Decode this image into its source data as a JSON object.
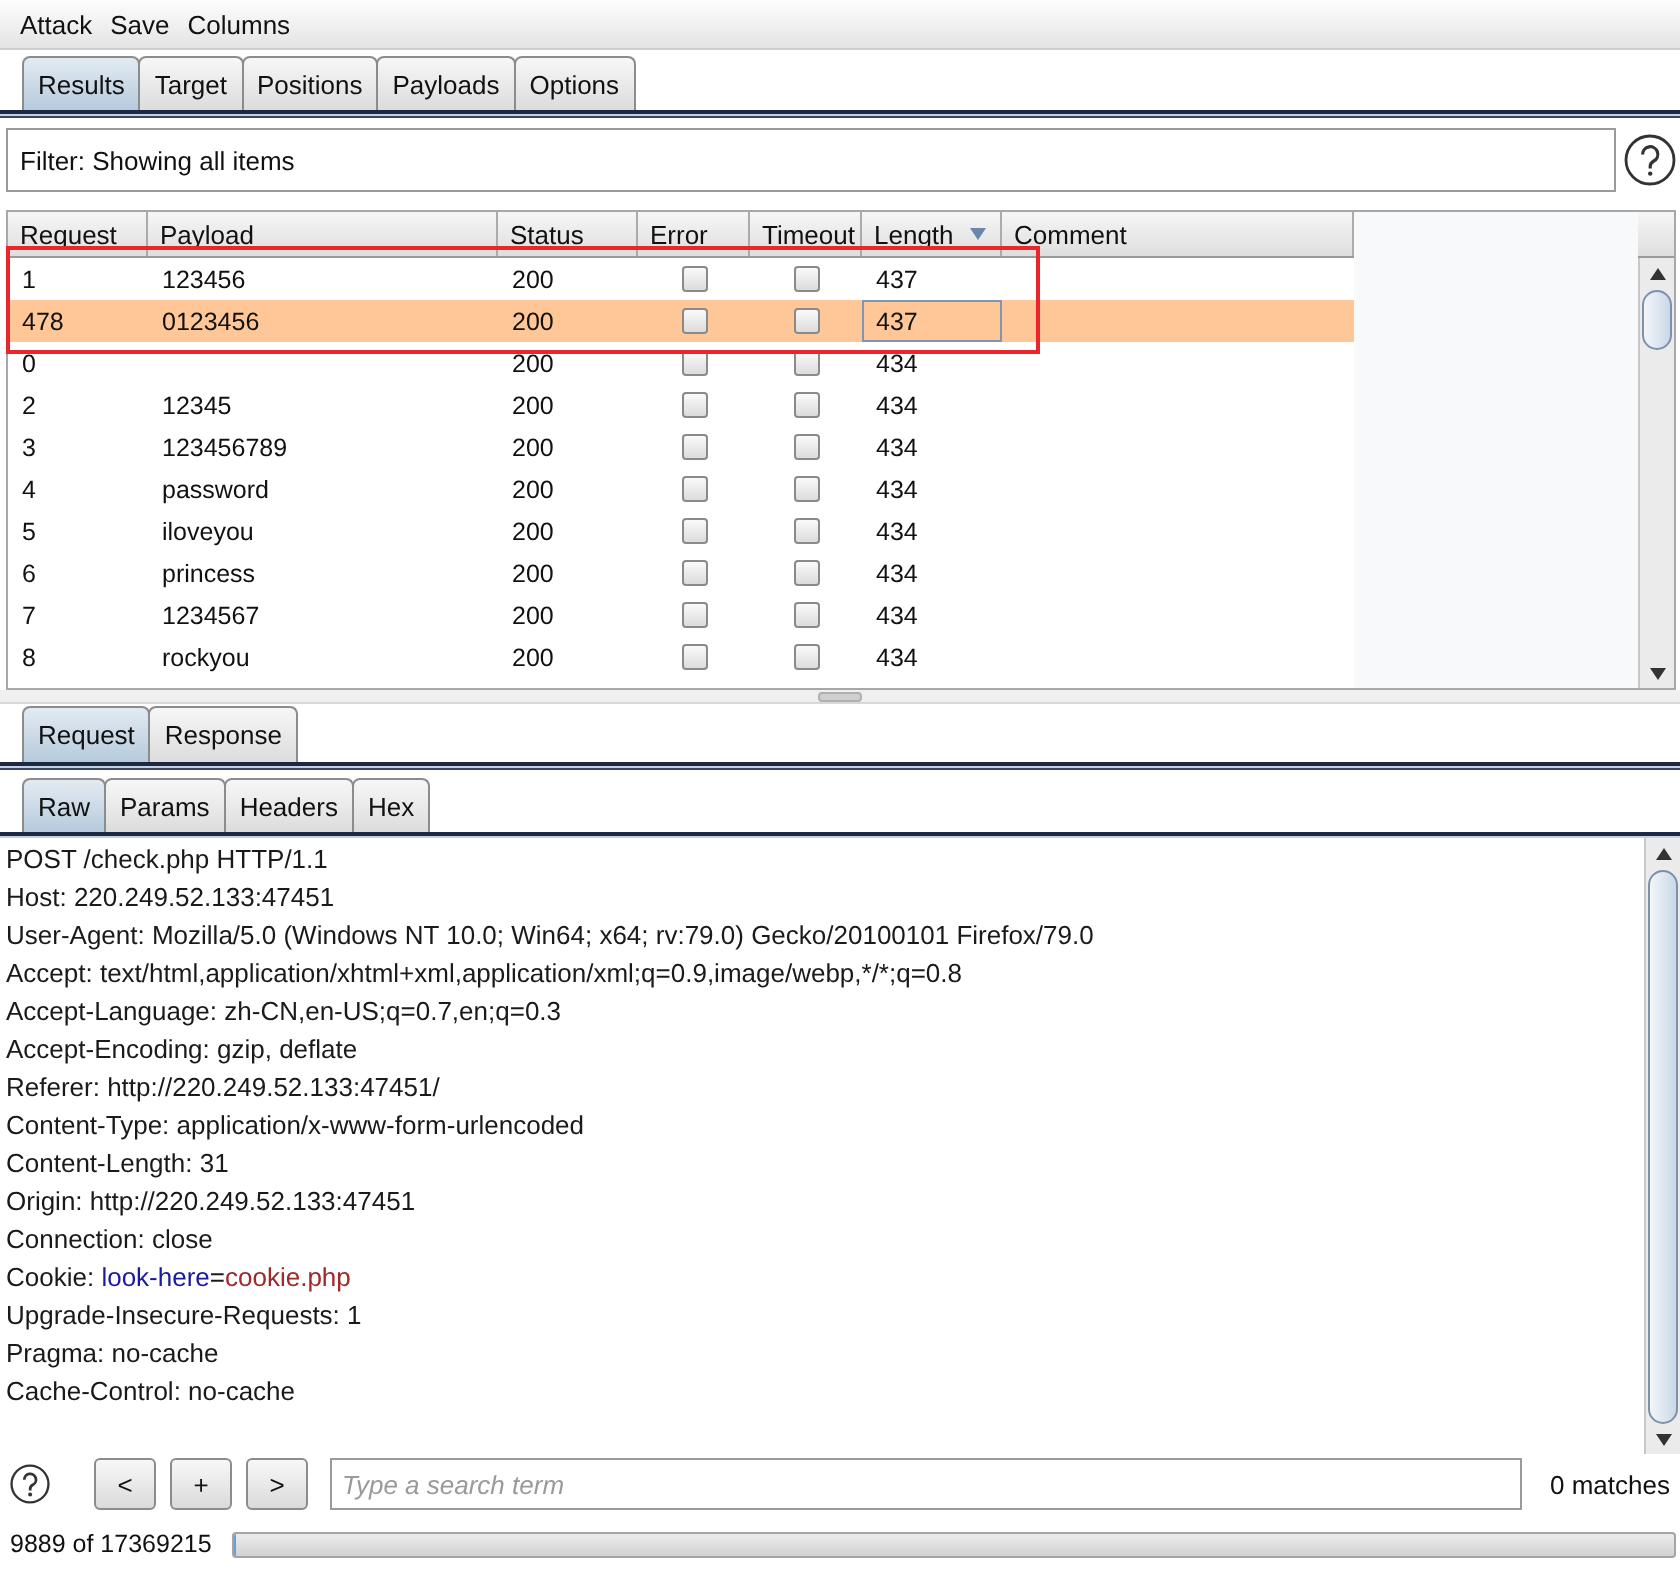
{
  "menu": [
    "Attack",
    "Save",
    "Columns"
  ],
  "tabs": [
    {
      "label": "Results",
      "selected": true
    },
    {
      "label": "Target",
      "selected": false
    },
    {
      "label": "Positions",
      "selected": false
    },
    {
      "label": "Payloads",
      "selected": false
    },
    {
      "label": "Options",
      "selected": false
    }
  ],
  "filter": {
    "text": "Filter: Showing all items"
  },
  "table": {
    "columns": [
      {
        "label": "Request",
        "sorted": false
      },
      {
        "label": "Payload",
        "sorted": false
      },
      {
        "label": "Status",
        "sorted": false
      },
      {
        "label": "Error",
        "sorted": false
      },
      {
        "label": "Timeout",
        "sorted": false
      },
      {
        "label": "Length",
        "sorted": true
      },
      {
        "label": "Comment",
        "sorted": false
      }
    ],
    "rows": [
      {
        "request": "1",
        "payload": "123456",
        "status": "200",
        "error": false,
        "timeout": false,
        "length": "437",
        "selected": false,
        "outlined": true
      },
      {
        "request": "478",
        "payload": "0123456",
        "status": "200",
        "error": false,
        "timeout": false,
        "length": "437",
        "selected": true,
        "outlined": true
      },
      {
        "request": "0",
        "status": "200",
        "error": false,
        "timeout": false,
        "length": "434",
        "selected": false,
        "outlined": false
      },
      {
        "request": "2",
        "payload": "12345",
        "status": "200",
        "error": false,
        "timeout": false,
        "length": "434",
        "selected": false,
        "outlined": false
      },
      {
        "request": "3",
        "payload": "123456789",
        "status": "200",
        "error": false,
        "timeout": false,
        "length": "434",
        "selected": false,
        "outlined": false
      },
      {
        "request": "4",
        "payload": "password",
        "status": "200",
        "error": false,
        "timeout": false,
        "length": "434",
        "selected": false,
        "outlined": false
      },
      {
        "request": "5",
        "payload": "iloveyou",
        "status": "200",
        "error": false,
        "timeout": false,
        "length": "434",
        "selected": false,
        "outlined": false
      },
      {
        "request": "6",
        "payload": "princess",
        "status": "200",
        "error": false,
        "timeout": false,
        "length": "434",
        "selected": false,
        "outlined": false
      },
      {
        "request": "7",
        "payload": "1234567",
        "status": "200",
        "error": false,
        "timeout": false,
        "length": "434",
        "selected": false,
        "outlined": false
      },
      {
        "request": "8",
        "payload": "rockyou",
        "status": "200",
        "error": false,
        "timeout": false,
        "length": "434",
        "selected": false,
        "outlined": false
      }
    ]
  },
  "message_tabs": [
    {
      "label": "Request",
      "selected": true
    },
    {
      "label": "Response",
      "selected": false
    }
  ],
  "view_tabs": [
    {
      "label": "Raw",
      "selected": true
    },
    {
      "label": "Params",
      "selected": false
    },
    {
      "label": "Headers",
      "selected": false
    },
    {
      "label": "Hex",
      "selected": false
    }
  ],
  "message": {
    "lines": [
      [
        {
          "kind": "plain",
          "text": "POST /check.php HTTP/1.1"
        }
      ],
      [
        {
          "kind": "plain",
          "text": "Host: 220.249.52.133:47451"
        }
      ],
      [
        {
          "kind": "plain",
          "text": "User-Agent: Mozilla/5.0 (Windows NT 10.0; Win64; x64; rv:79.0) Gecko/20100101 Firefox/79.0"
        }
      ],
      [
        {
          "kind": "plain",
          "text": "Accept: text/html,application/xhtml+xml,application/xml;q=0.9,image/webp,*/*;q=0.8"
        }
      ],
      [
        {
          "kind": "plain",
          "text": "Accept-Language: zh-CN,en-US;q=0.7,en;q=0.3"
        }
      ],
      [
        {
          "kind": "plain",
          "text": "Accept-Encoding: gzip, deflate"
        }
      ],
      [
        {
          "kind": "plain",
          "text": "Referer: http://220.249.52.133:47451/"
        }
      ],
      [
        {
          "kind": "plain",
          "text": "Content-Type: application/x-www-form-urlencoded"
        }
      ],
      [
        {
          "kind": "plain",
          "text": "Content-Length: 31"
        }
      ],
      [
        {
          "kind": "plain",
          "text": "Origin: http://220.249.52.133:47451"
        }
      ],
      [
        {
          "kind": "plain",
          "text": "Connection: close"
        }
      ],
      [
        {
          "kind": "plain",
          "text": "Cookie: "
        },
        {
          "kind": "param-name",
          "text": "look-here"
        },
        {
          "kind": "plain",
          "text": "="
        },
        {
          "kind": "param-value",
          "text": "cookie.php"
        }
      ],
      [
        {
          "kind": "plain",
          "text": "Upgrade-Insecure-Requests: 1"
        }
      ],
      [
        {
          "kind": "plain",
          "text": "Pragma: no-cache"
        }
      ],
      [
        {
          "kind": "plain",
          "text": "Cache-Control: no-cache"
        }
      ]
    ]
  },
  "search": {
    "buttons": [
      "<",
      "+",
      ">"
    ],
    "placeholder": "Type a search term",
    "matches": "0 matches"
  },
  "status_bar": {
    "progress": "9889 of 17369215",
    "level": 0.0006
  }
}
